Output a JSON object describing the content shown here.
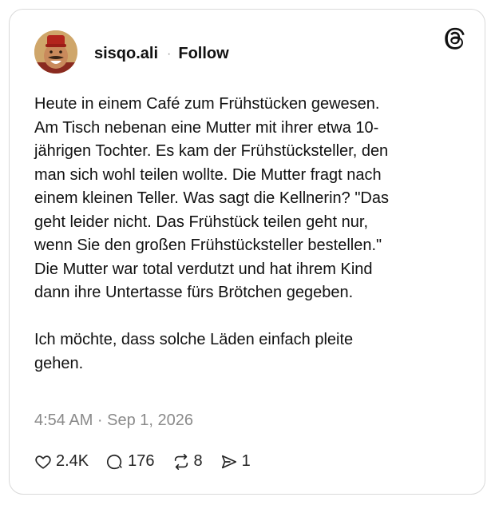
{
  "author": {
    "username": "sisqo.ali",
    "separator": "·",
    "follow_label": "Follow"
  },
  "post": {
    "text": "Heute in einem Café zum Frühstücken gewesen.\nAm Tisch nebenan eine Mutter mit ihrer etwa 10-\njährigen Tochter. Es kam der Frühstücksteller, den\nman sich wohl teilen wollte. Die Mutter fragt nach\neinem kleinen Teller. Was sagt die Kellnerin? \"Das\ngeht leider nicht. Das Frühstück teilen geht nur,\nwenn Sie den großen Frühstücksteller bestellen.\"\nDie Mutter war total verdutzt und hat ihrem Kind\ndann ihre Untertasse fürs Brötchen gegeben.\n\nIch möchte, dass solche Läden einfach pleite\ngehen.",
    "timestamp": "4:54 AM · Sep 1, 2026"
  },
  "actions": {
    "likes": "2.4K",
    "replies": "176",
    "reposts": "8",
    "shares": "1"
  },
  "icons": {
    "brand": "threads-logo-icon",
    "like": "heart-icon",
    "reply": "reply-icon",
    "repost": "repost-icon",
    "share": "share-icon"
  }
}
